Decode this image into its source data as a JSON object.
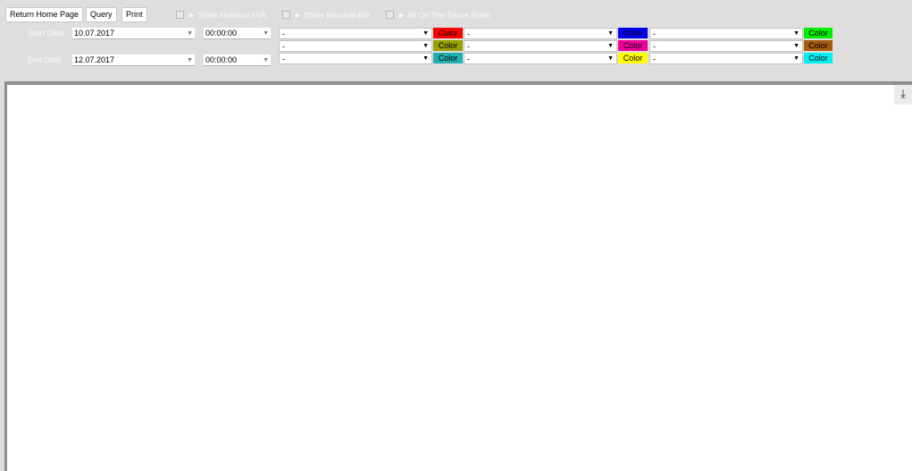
{
  "toolbar": {
    "return_home": "Return Home Page",
    "query": "Query",
    "print": "Print"
  },
  "options": {
    "show_nominal_kva": "► Show Nominal kVA",
    "show_nominal_kw": "► Show Nominal kW",
    "same_scale": "► All On The Same Scale"
  },
  "range": {
    "start_label": "Start Date :",
    "start_date": "10.07.2017",
    "start_time": "00:00:00",
    "end_label": "End Date :",
    "end_date": "12.07.2017",
    "end_time": "00:00:00"
  },
  "channel_placeholder": "-",
  "color_label": "Color",
  "channels": [
    {
      "value": "-",
      "color_label": "Color",
      "color": "#ff0000"
    },
    {
      "value": "-",
      "color_label": "Color",
      "color": "#0000ee"
    },
    {
      "value": "-",
      "color_label": "Color",
      "color": "#00ee00"
    },
    {
      "value": "-",
      "color_label": "Color",
      "color": "#99a000"
    },
    {
      "value": "-",
      "color_label": "Color",
      "color": "#ee0099"
    },
    {
      "value": "-",
      "color_label": "Color",
      "color": "#a65a10"
    },
    {
      "value": "-",
      "color_label": "Color",
      "color": "#20b0b0"
    },
    {
      "value": "-",
      "color_label": "Color",
      "color": "#ffff00"
    },
    {
      "value": "-",
      "color_label": "Color",
      "color": "#00f0f0"
    }
  ],
  "icons": {
    "dropdown": "▼",
    "download": "⤓"
  }
}
